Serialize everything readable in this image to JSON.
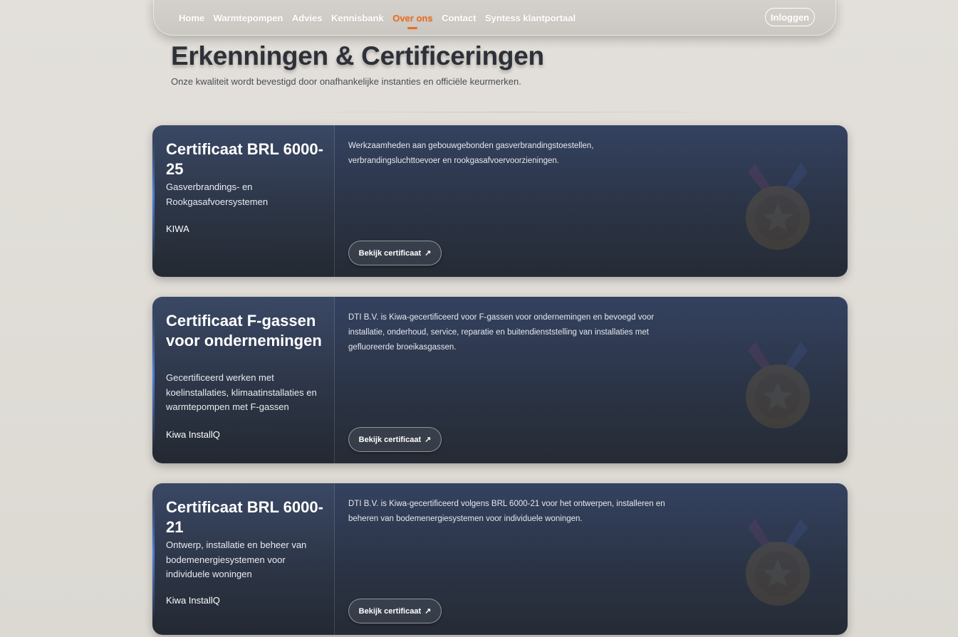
{
  "nav": {
    "links": [
      {
        "label": "Home",
        "active": false
      },
      {
        "label": "Warmtepompen",
        "active": false
      },
      {
        "label": "Advies",
        "active": false
      },
      {
        "label": "Kennisbank",
        "active": false
      },
      {
        "label": "Over ons",
        "active": true
      },
      {
        "label": "Contact",
        "active": false
      },
      {
        "label": "Syntess klantportaal",
        "active": false
      }
    ],
    "login_label": "Inloggen"
  },
  "header": {
    "title": "Erkenningen & Certificeringen",
    "subtitle": "Onze kwaliteit wordt bevestigd door onafhankelijke instanties en officiële keurmerken."
  },
  "certificates": [
    {
      "title": "Certificaat BRL 6000-25",
      "subtitle": "Gasverbrandings- en Rookgasafvoersystemen",
      "issuer": "KIWA",
      "description": "Werkzaamheden aan gebouwgebonden gasverbrandingstoestellen, verbrandingsluchttoevoer en rookgasafvoervoorzieningen.",
      "button_label": "Bekijk certificaat",
      "button_icon": "↗"
    },
    {
      "title": "Certificaat F-gassen voor ondernemingen",
      "subtitle": "Gecertificeerd werken met koelinstallaties, klimaatinstallaties en warmtepompen met F-gassen",
      "issuer": "Kiwa InstallQ",
      "description": "DTI B.V. is Kiwa-gecertificeerd voor F-gassen voor ondernemingen en bevoegd voor installatie, onderhoud, service, reparatie en buitendienststelling van installaties met gefluoreerde broeikasgassen.",
      "button_label": "Bekijk certificaat",
      "button_icon": "↗"
    },
    {
      "title": "Certificaat BRL 6000-21",
      "subtitle": "Ontwerp, installatie en beheer van bodemenergiesystemen voor individuele woningen",
      "issuer": "Kiwa InstallQ",
      "description": "DTI B.V. is Kiwa-gecertificeerd volgens BRL 6000-21 voor het ontwerpen, installeren en beheren van bodemenergiesystemen voor individuele woningen.",
      "button_label": "Bekijk certificaat",
      "button_icon": "↗"
    }
  ],
  "colors": {
    "accent": "#f06a1d",
    "card_top": "#344260",
    "card_bottom": "#262b35",
    "card_accent_line": "#4f7fd8"
  },
  "icons": {
    "decoration": "medal-icon",
    "button": "external-link-arrow-icon"
  }
}
